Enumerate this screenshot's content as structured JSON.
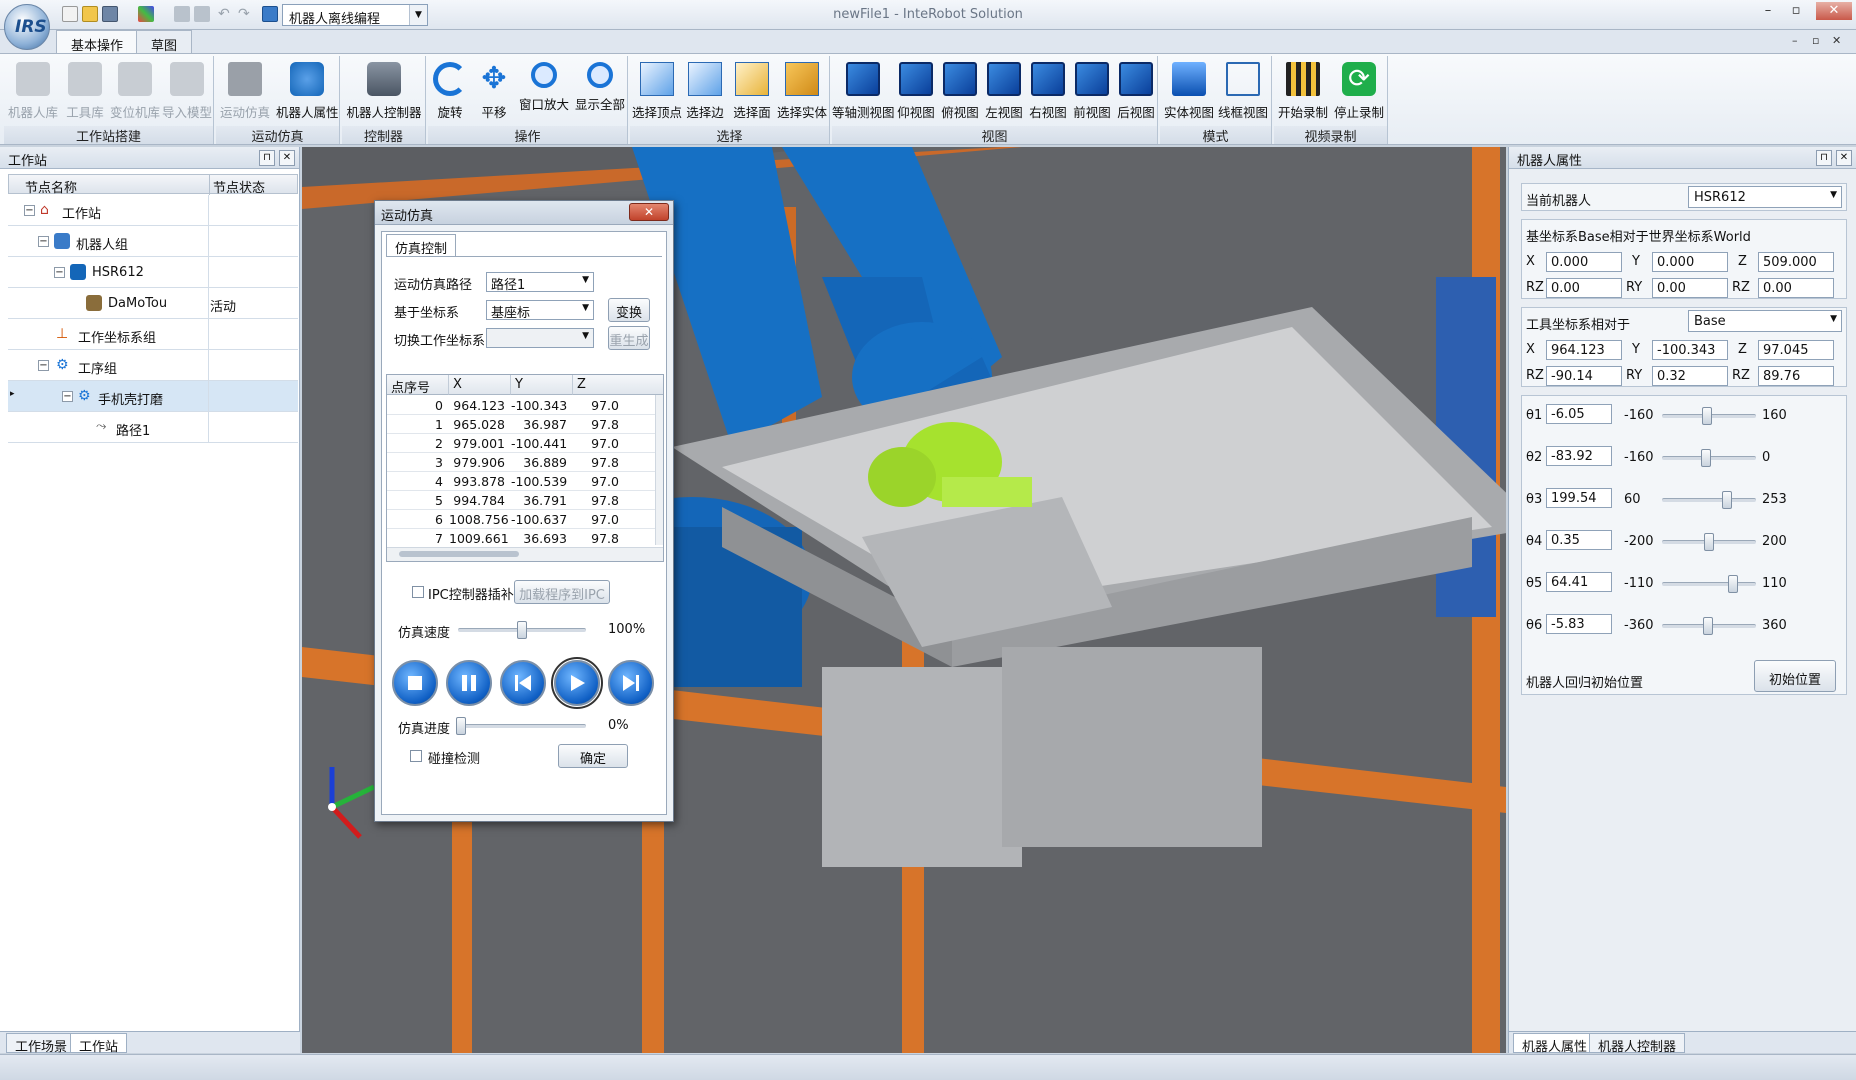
{
  "app": {
    "window_title": "newFile1 - InteRobot Solution",
    "quick_combo": "机器人离线编程"
  },
  "ribbon": {
    "tabs": [
      "基本操作",
      "草图"
    ],
    "groups": [
      {
        "title": "工作站搭建",
        "buttons": [
          "机器人库",
          "工具库",
          "变位机库",
          "导入模型"
        ]
      },
      {
        "title": "运动仿真",
        "buttons": [
          "运动仿真",
          "机器人属性"
        ]
      },
      {
        "title": "控制器",
        "buttons": [
          "机器人控制器"
        ]
      },
      {
        "title": "操作",
        "buttons": [
          "旋转",
          "平移",
          "窗口放大",
          "显示全部"
        ]
      },
      {
        "title": "选择",
        "buttons": [
          "选择顶点",
          "选择边",
          "选择面",
          "选择实体"
        ]
      },
      {
        "title": "视图",
        "buttons": [
          "等轴测视图",
          "仰视图",
          "俯视图",
          "左视图",
          "右视图",
          "前视图",
          "后视图"
        ]
      },
      {
        "title": "模式",
        "buttons": [
          "实体视图",
          "线框视图"
        ]
      },
      {
        "title": "视频录制",
        "buttons": [
          "开始录制",
          "停止录制"
        ]
      }
    ]
  },
  "left_panel": {
    "title": "工作站",
    "columns": [
      "节点名称",
      "节点状态"
    ],
    "tree": [
      {
        "label": "工作站",
        "status": ""
      },
      {
        "label": "机器人组",
        "status": ""
      },
      {
        "label": "HSR612",
        "status": ""
      },
      {
        "label": "DaMoTou",
        "status": "活动"
      },
      {
        "label": "工作坐标系组",
        "status": ""
      },
      {
        "label": "工序组",
        "status": ""
      },
      {
        "label": "手机壳打磨",
        "status": ""
      },
      {
        "label": "路径1",
        "status": ""
      }
    ],
    "bottom_tabs": [
      "工作场景",
      "工作站"
    ]
  },
  "dialog": {
    "title": "运动仿真",
    "close": "✕",
    "tab": "仿真控制",
    "path_label": "运动仿真路径",
    "path_value": "路径1",
    "coord_label": "基于坐标系",
    "coord_value": "基座标",
    "transform_button": "变换",
    "switch_label": "切换工作坐标系",
    "regen_button": "重生成",
    "table_columns": [
      "点序号",
      "X",
      "Y",
      "Z"
    ],
    "points": [
      {
        "idx": "0",
        "x": "964.123",
        "y": "-100.343",
        "z": "97.0"
      },
      {
        "idx": "1",
        "x": "965.028",
        "y": "36.987",
        "z": "97.8"
      },
      {
        "idx": "2",
        "x": "979.001",
        "y": "-100.441",
        "z": "97.0"
      },
      {
        "idx": "3",
        "x": "979.906",
        "y": "36.889",
        "z": "97.8"
      },
      {
        "idx": "4",
        "x": "993.878",
        "y": "-100.539",
        "z": "97.0"
      },
      {
        "idx": "5",
        "x": "994.784",
        "y": "36.791",
        "z": "97.8"
      },
      {
        "idx": "6",
        "x": "1008.756",
        "y": "-100.637",
        "z": "97.0"
      },
      {
        "idx": "7",
        "x": "1009.661",
        "y": "36.693",
        "z": "97.8"
      }
    ],
    "ipc_label": "IPC控制器插补",
    "load_button": "加载程序到IPC",
    "speed_label": "仿真速度",
    "speed_value": "100%",
    "speed_fraction": 0.5,
    "progress_label": "仿真进度",
    "progress_value": "0%",
    "collision_label": "碰撞检测",
    "ok_button": "确定"
  },
  "right_panel": {
    "title": "机器人属性",
    "current_robot_label": "当前机器人",
    "current_robot": "HSR612",
    "base_title": "基坐标系Base相对于世界坐标系World",
    "base": {
      "x": "0.000",
      "y": "0.000",
      "z": "509.000",
      "rz": "0.00",
      "ry": "0.00",
      "rx": "0.00"
    },
    "tool_title": "工具坐标系相对于",
    "tool_ref": "Base",
    "tool": {
      "x": "964.123",
      "y": "-100.343",
      "z": "97.045",
      "rz": "-90.14",
      "ry": "0.32",
      "rx": "89.76"
    },
    "axis_labels": {
      "x": "X",
      "y": "Y",
      "z": "Z",
      "rz": "RZ",
      "ry": "RY"
    },
    "joints": [
      {
        "name": "θ1",
        "value": "-6.05",
        "min": "-160",
        "max": "160",
        "frac": 0.48
      },
      {
        "name": "θ2",
        "value": "-83.92",
        "min": "-160",
        "max": "0",
        "frac": 0.47
      },
      {
        "name": "θ3",
        "value": "199.54",
        "min": "60",
        "max": "253",
        "frac": 0.72
      },
      {
        "name": "θ4",
        "value": "0.35",
        "min": "-200",
        "max": "200",
        "frac": 0.5
      },
      {
        "name": "θ5",
        "value": "64.41",
        "min": "-110",
        "max": "110",
        "frac": 0.79
      },
      {
        "name": "θ6",
        "value": "-5.83",
        "min": "-360",
        "max": "360",
        "frac": 0.49
      }
    ],
    "home_label": "机器人回归初始位置",
    "home_button": "初始位置",
    "bottom_tabs": [
      "机器人属性",
      "机器人控制器"
    ]
  },
  "colors": {
    "robot": "#1466b8",
    "part": "#a6e22e",
    "frame": "#d7742a",
    "floor": "#5d5f63"
  }
}
